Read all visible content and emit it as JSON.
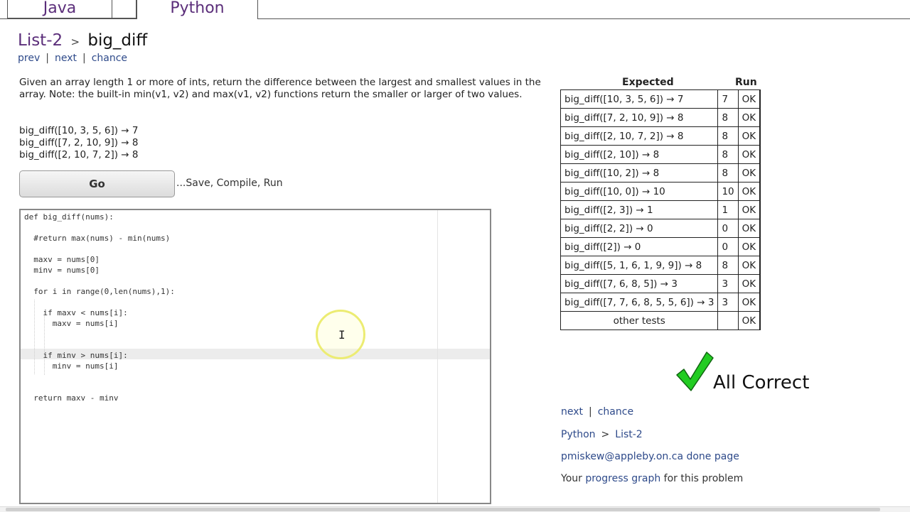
{
  "tabs": {
    "java": "Java",
    "python": "Python"
  },
  "title": {
    "section": "List-2",
    "separator": ">",
    "problem": "big_diff"
  },
  "nav_top": {
    "prev": "prev",
    "sep1": "|",
    "next": "next",
    "sep2": "|",
    "chance": "chance"
  },
  "description": "Given an array length 1 or more of ints, return the difference between the largest and smallest values in the array. Note: the built-in min(v1, v2) and max(v1, v2) functions return the smaller or larger of two values.",
  "examples": [
    "big_diff([10, 3, 5, 6]) → 7",
    "big_diff([7, 2, 10, 9]) → 8",
    "big_diff([2, 10, 7, 2]) → 8"
  ],
  "go_button": "Go",
  "go_hint": "...Save, Compile, Run",
  "code": "def big_diff(nums):\n\n  #return max(nums) - min(nums)\n\n  maxv = nums[0]\n  minv = nums[0]\n\n  for i in range(0,len(nums),1):\n\n    if maxv < nums[i]:\n      maxv = nums[i]\n\n\n    if minv > nums[i]:\n      minv = nums[i]\n\n\n  return maxv - minv",
  "results": {
    "col_expected": "Expected",
    "col_run": "Run",
    "rows": [
      {
        "call": "big_diff([10, 3, 5, 6]) → 7",
        "run": "7",
        "status": "OK"
      },
      {
        "call": "big_diff([7, 2, 10, 9]) → 8",
        "run": "8",
        "status": "OK"
      },
      {
        "call": "big_diff([2, 10, 7, 2]) → 8",
        "run": "8",
        "status": "OK"
      },
      {
        "call": "big_diff([2, 10]) → 8",
        "run": "8",
        "status": "OK"
      },
      {
        "call": "big_diff([10, 2]) → 8",
        "run": "8",
        "status": "OK"
      },
      {
        "call": "big_diff([10, 0]) → 10",
        "run": "10",
        "status": "OK"
      },
      {
        "call": "big_diff([2, 3]) → 1",
        "run": "1",
        "status": "OK"
      },
      {
        "call": "big_diff([2, 2]) → 0",
        "run": "0",
        "status": "OK"
      },
      {
        "call": "big_diff([2]) → 0",
        "run": "0",
        "status": "OK"
      },
      {
        "call": "big_diff([5, 1, 6, 1, 9, 9]) → 8",
        "run": "8",
        "status": "OK"
      },
      {
        "call": "big_diff([7, 6, 8, 5]) → 3",
        "run": "3",
        "status": "OK"
      },
      {
        "call": "big_diff([7, 7, 6, 8, 5, 5, 6]) → 3",
        "run": "3",
        "status": "OK"
      }
    ],
    "other": {
      "label": "other tests",
      "run": "",
      "status": "OK"
    },
    "pass_color": "#107a10"
  },
  "all_correct": "All Correct",
  "check_color": "#22cc22",
  "nav_bottom": {
    "next": "next",
    "sep": "|",
    "chance": "chance"
  },
  "breadcrumb": {
    "language": "Python",
    "sep": ">",
    "section": "List-2"
  },
  "user": {
    "email": "pmiskew@appleby.on.ca",
    "done_page": "done page"
  },
  "progress": {
    "prefix": "Your",
    "link": "progress graph",
    "suffix": "for this problem"
  }
}
